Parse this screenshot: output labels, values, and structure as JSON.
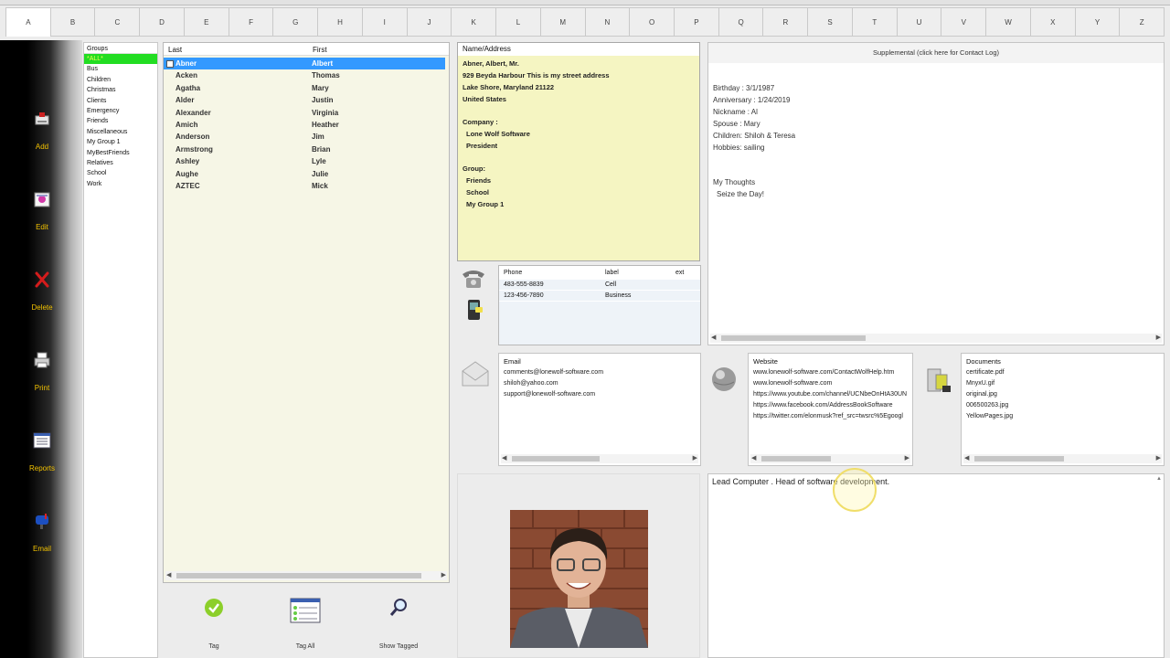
{
  "alphabet": [
    "A",
    "B",
    "C",
    "D",
    "E",
    "F",
    "G",
    "H",
    "I",
    "J",
    "K",
    "L",
    "M",
    "N",
    "O",
    "P",
    "Q",
    "R",
    "S",
    "T",
    "U",
    "V",
    "W",
    "X",
    "Y",
    "Z"
  ],
  "toolbar": {
    "add": "Add",
    "edit": "Edit",
    "delete": "Delete",
    "print": "Print",
    "reports": "Reports",
    "email": "Email"
  },
  "groups": {
    "header": "Groups",
    "items": [
      "*ALL*",
      "Bus",
      "Children",
      "Christmas",
      "Clients",
      "Emergency",
      "Friends",
      "Miscellaneous",
      "My Group 1",
      "MyBestFriends",
      "Relatives",
      "School",
      "Work"
    ]
  },
  "contacts": {
    "col_last": "Last",
    "col_first": "First",
    "rows": [
      {
        "last": "Abner",
        "first": "Albert"
      },
      {
        "last": "Acken",
        "first": "Thomas"
      },
      {
        "last": "Agatha",
        "first": "Mary"
      },
      {
        "last": "Alder",
        "first": "Justin"
      },
      {
        "last": "Alexander",
        "first": "Virginia"
      },
      {
        "last": "Amich",
        "first": "Heather"
      },
      {
        "last": "Anderson",
        "first": "Jim"
      },
      {
        "last": "Armstrong",
        "first": "Brian"
      },
      {
        "last": "Ashley",
        "first": "Lyle"
      },
      {
        "last": "Aughe",
        "first": "Julie"
      },
      {
        "last": "AZTEC",
        "first": "Mick"
      }
    ]
  },
  "bottom_buttons": {
    "tag": "Tag",
    "tag_all": "Tag All",
    "show_tagged": "Show Tagged"
  },
  "name_address": {
    "header": "Name/Address",
    "name": "Abner, Albert, Mr.",
    "address1": "929 Beyda Harbour This is my street address",
    "address2": "Lake Shore, Maryland  21122",
    "country": "United States",
    "company_label": "Company :",
    "company": "Lone Wolf Software",
    "title": "President",
    "group_label": "Group:",
    "groups": [
      "Friends",
      "School",
      "My Group 1"
    ]
  },
  "supplemental": {
    "header": "Supplemental (click here for Contact Log)",
    "lines": [
      "Birthday :  3/1/1987",
      "Anniversary :  1/24/2019",
      "Nickname :  Al",
      "Spouse :  Mary",
      "Children:  Shiloh & Teresa",
      "Hobbies:  sailing"
    ],
    "thoughts_label": "My Thoughts",
    "thoughts": "Seize the Day!"
  },
  "phone": {
    "col_phone": "Phone",
    "col_label": "label",
    "col_ext": "ext",
    "rows": [
      {
        "phone": "483-555-8839",
        "label": "Cell"
      },
      {
        "phone": "123-456-7890",
        "label": "Business"
      }
    ]
  },
  "email": {
    "header": "Email",
    "items": [
      "comments@lonewolf-software.com",
      "shiloh@yahoo.com",
      "support@lonewolf-software.com"
    ]
  },
  "website": {
    "header": "Website",
    "items": [
      "www.lonewolf-software.com/ContactWolfHelp.htm",
      "www.lonewolf-software.com",
      "https://www.youtube.com/channel/UCNbeOnHtA30UN",
      "https://www.facebook.com/AddressBookSoftware",
      "https://twitter.com/elonmusk?ref_src=twsrc%5Egoogl"
    ]
  },
  "documents": {
    "header": "Documents",
    "items": [
      "certificate.pdf",
      "MnyxU.gif",
      "original.jpg",
      "006500263.jpg",
      "YellowPages.jpg"
    ]
  },
  "notes": {
    "text": "Lead Computer . Head of software development."
  }
}
